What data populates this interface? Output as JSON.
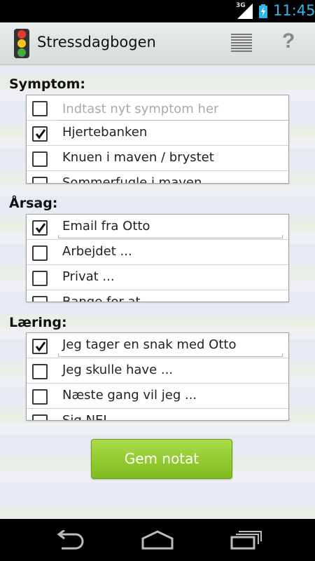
{
  "status_bar": {
    "network": "3G",
    "time": "11:45"
  },
  "action_bar": {
    "title": "Stressdagbogen",
    "icons": [
      "traffic-light-icon",
      "list-icon",
      "help-icon"
    ],
    "help_label": "?"
  },
  "sections": [
    {
      "title": "Symptom:",
      "input_placeholder": "Indtast nyt symptom her",
      "items": [
        {
          "label": "Hjertebanken",
          "checked": true
        },
        {
          "label": "Knuen i maven / brystet",
          "checked": false
        },
        {
          "label": "Sommerfugle i maven",
          "checked": false
        }
      ]
    },
    {
      "title": "Årsag:",
      "items": [
        {
          "label": "Email fra Otto",
          "checked": true,
          "underlined": true
        },
        {
          "label": "Arbejdet ...",
          "checked": false
        },
        {
          "label": "Privat ...",
          "checked": false
        },
        {
          "label": "Bange for at ...",
          "checked": false
        }
      ]
    },
    {
      "title": "Læring:",
      "items": [
        {
          "label": "Jeg tager en snak med Otto",
          "checked": true,
          "underlined": true
        },
        {
          "label": "Jeg skulle have ...",
          "checked": false
        },
        {
          "label": "Næste gang vil jeg ...",
          "checked": false
        },
        {
          "label": "Sig NEJ ...",
          "checked": false
        }
      ]
    }
  ],
  "save_button": {
    "label": "Gem notat"
  },
  "nav_bar": {
    "icons": [
      "back-icon",
      "home-icon",
      "recent-apps-icon"
    ]
  },
  "colors": {
    "accent_time": "#33b5e5",
    "button_green": "#8cc63f"
  }
}
